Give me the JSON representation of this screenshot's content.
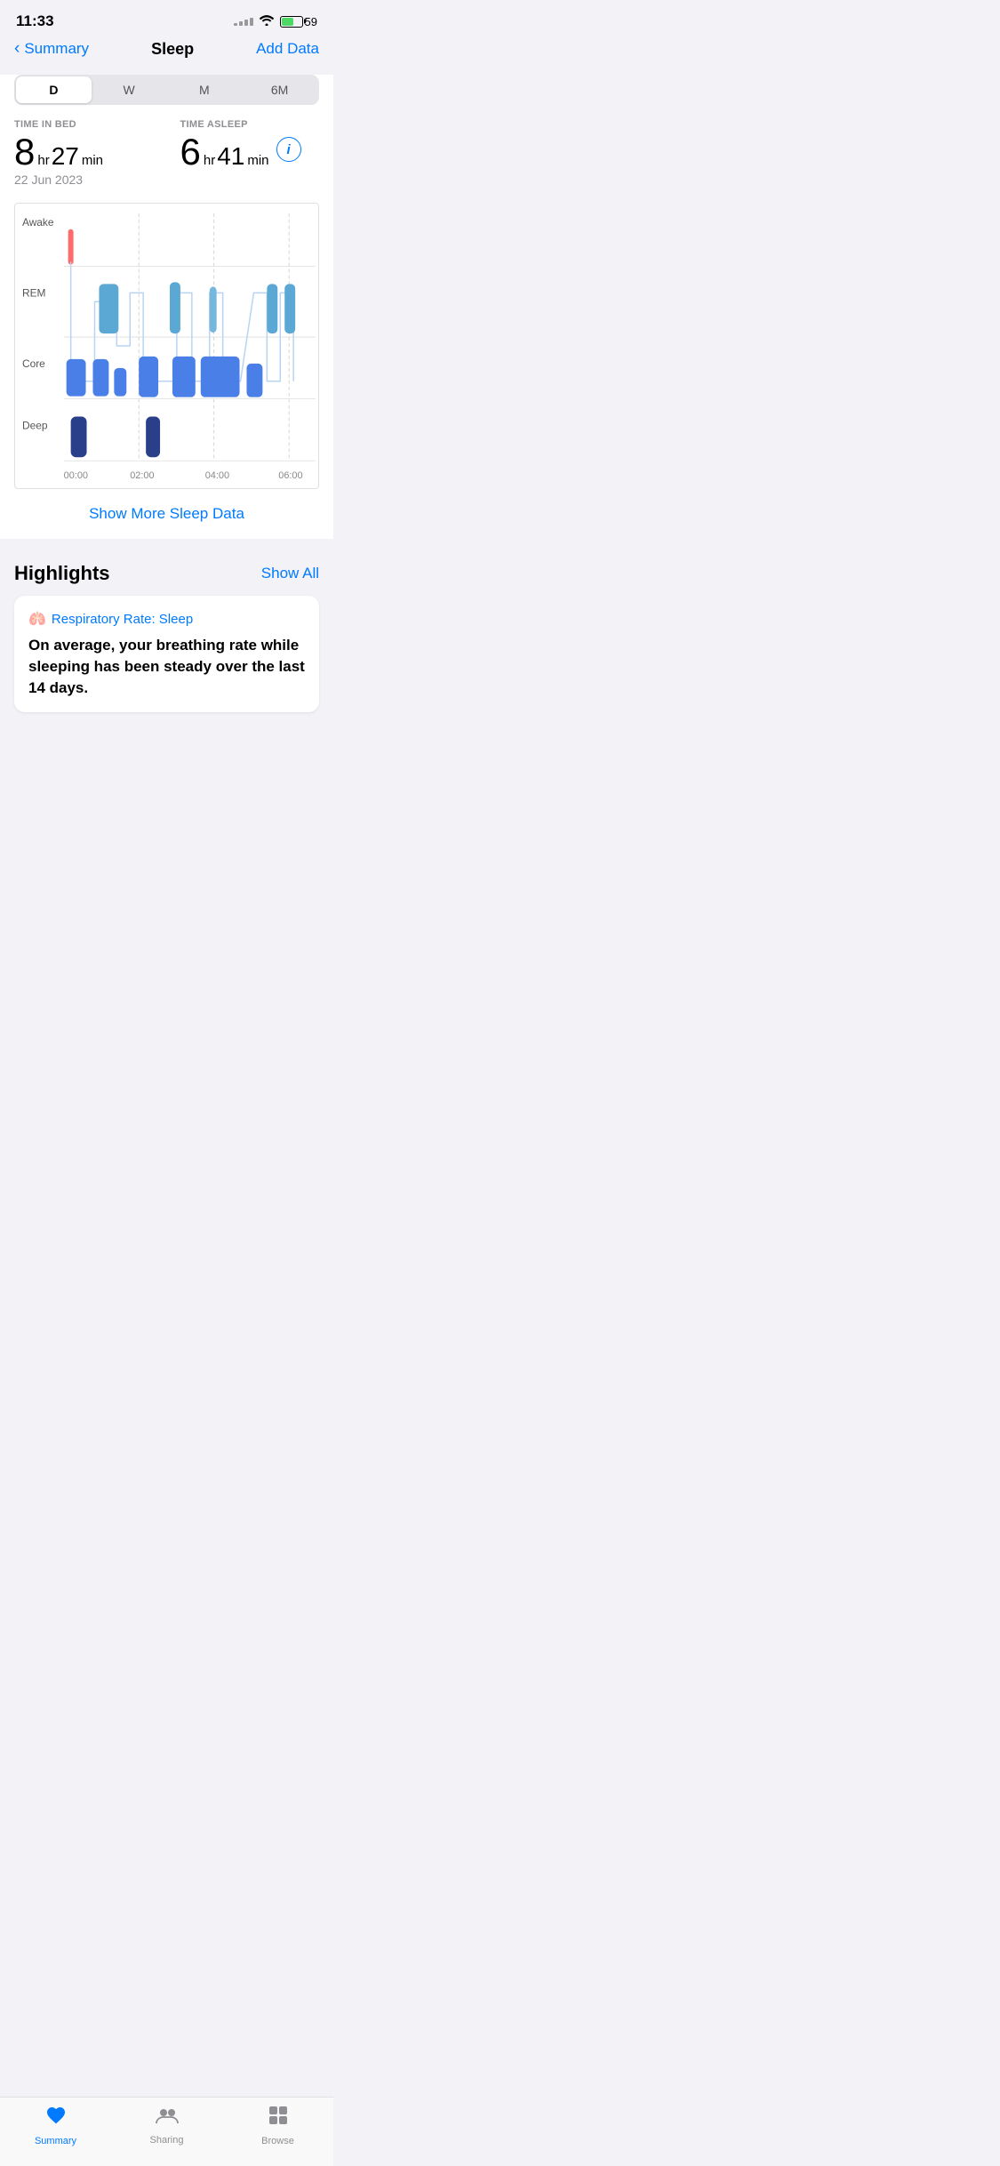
{
  "statusBar": {
    "time": "11:33",
    "battery": "59"
  },
  "navBar": {
    "backLabel": "Summary",
    "title": "Sleep",
    "actionLabel": "Add Data"
  },
  "periodSelector": {
    "options": [
      "D",
      "W",
      "M",
      "6M"
    ],
    "active": 0
  },
  "sleepStats": {
    "timeInBedLabel": "TIME IN BED",
    "timeInBed": {
      "hours": "8",
      "hrUnit": "hr",
      "minutes": "27",
      "minUnit": "min"
    },
    "timeAsleepLabel": "TIME ASLEEP",
    "timeAsleep": {
      "hours": "6",
      "hrUnit": "hr",
      "minutes": "41",
      "minUnit": "min"
    },
    "date": "22 Jun 2023"
  },
  "chart": {
    "yLabels": [
      "Awake",
      "REM",
      "Core",
      "Deep"
    ],
    "xLabels": [
      "00:00",
      "02:00",
      "04:00",
      "06:00"
    ]
  },
  "showMoreLink": "Show More Sleep Data",
  "highlights": {
    "title": "Highlights",
    "showAllLabel": "Show All",
    "card": {
      "iconText": "🫁",
      "titleText": "Respiratory Rate: Sleep",
      "bodyText": "On average, your breathing rate while sleeping has been steady over the last 14 days."
    }
  },
  "tabBar": {
    "items": [
      {
        "id": "summary",
        "label": "Summary",
        "active": true
      },
      {
        "id": "sharing",
        "label": "Sharing",
        "active": false
      },
      {
        "id": "browse",
        "label": "Browse",
        "active": false
      }
    ]
  }
}
